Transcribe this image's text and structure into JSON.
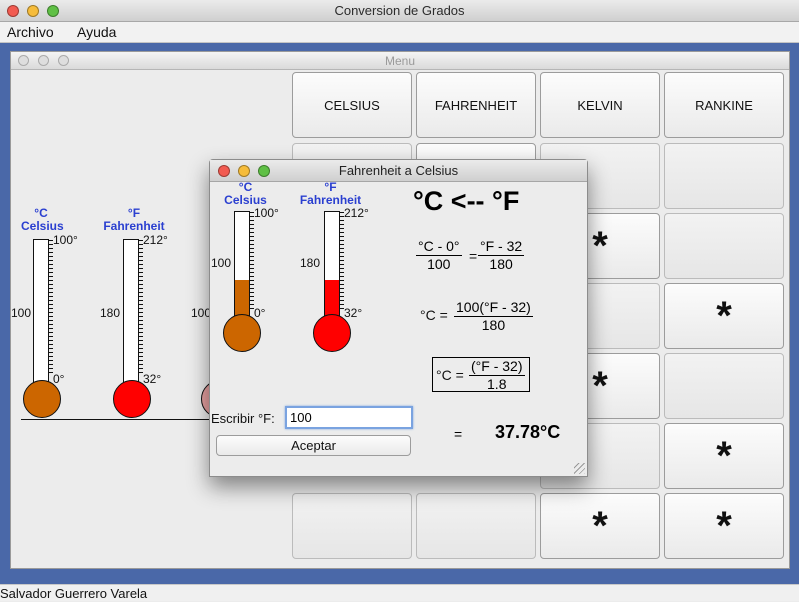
{
  "window": {
    "title": "Conversion de Grados"
  },
  "menubar": {
    "items": [
      "Archivo",
      "Ayuda"
    ]
  },
  "internal_frame": {
    "title": "Menu"
  },
  "grid": {
    "headers": [
      "CELSIUS",
      "FAHRENHEIT",
      "KELVIN",
      "RANKINE"
    ],
    "star": "*"
  },
  "bg_thermometers": [
    {
      "unit": "°C",
      "name": "Celsius",
      "top": "100°",
      "mid": "100",
      "bottom": "0°",
      "color": "#cc6600"
    },
    {
      "unit": "°F",
      "name": "Fahrenheit",
      "top": "212°",
      "mid": "180",
      "bottom": "32°",
      "color": "#ff0000"
    },
    {
      "partial_mid": "100"
    }
  ],
  "dialog": {
    "title": "Fahrenheit a Celsius",
    "thermo_c": {
      "unit": "°C",
      "name": "Celsius",
      "top": "100°",
      "mid": "100",
      "bottom": "0°",
      "color": "#cc6600",
      "fill_fraction": 0.38
    },
    "thermo_f": {
      "unit": "°F",
      "name": "Fahrenheit",
      "top": "212°",
      "mid": "180",
      "bottom": "32°",
      "color": "#ff0000",
      "fill_fraction": 0.38
    },
    "heading": "°C <-- °F",
    "formula1": {
      "num_left": "°C - 0°",
      "den_left": "100",
      "eq": "=",
      "num_right": "°F - 32",
      "den_right": "180"
    },
    "formula2": {
      "lhs": "°C =",
      "num": "100(°F - 32)",
      "den": "180"
    },
    "formula3": {
      "lhs": "°C =",
      "num": "(°F - 32)",
      "den": "1.8"
    },
    "input_label": "Escribir °F:",
    "input_value": "100",
    "accept_label": "Aceptar",
    "result_eq": "=",
    "result": "37.78°C"
  },
  "status": {
    "text": "Salvador Guerrero Varela"
  },
  "colors": {
    "desktop": "#4a68a8",
    "celsius": "#cc6600",
    "fahrenheit": "#ff0000",
    "label_blue": "#2a3fd0"
  }
}
